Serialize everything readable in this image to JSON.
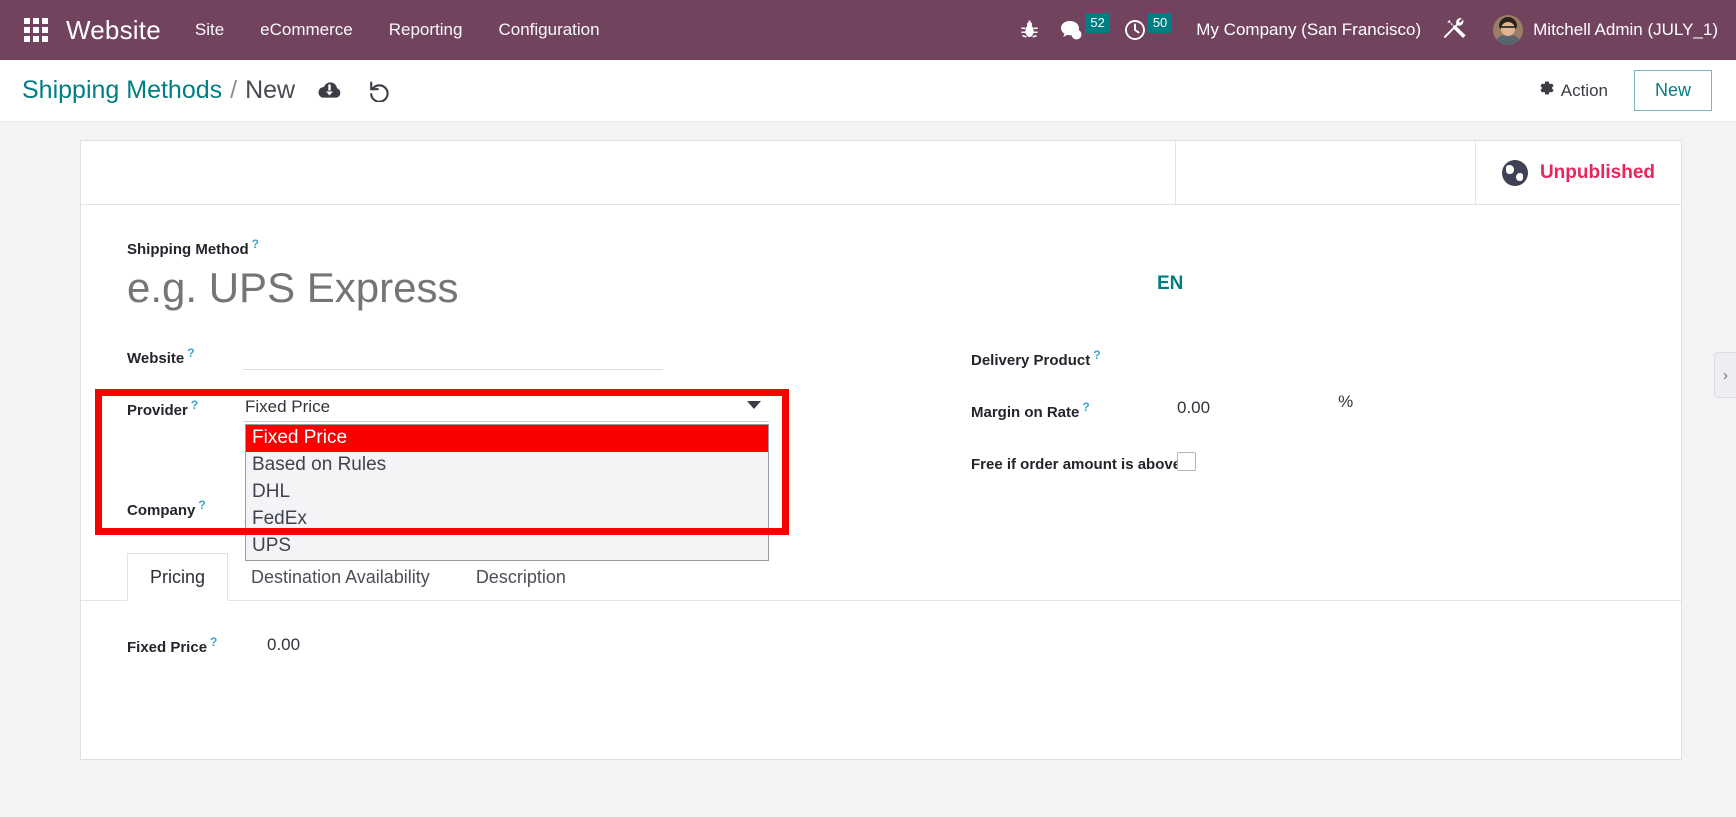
{
  "navbar": {
    "apps_icon": "apps-grid-icon",
    "brand": "Website",
    "menus": [
      {
        "label": "Site"
      },
      {
        "label": "eCommerce"
      },
      {
        "label": "Reporting"
      },
      {
        "label": "Configuration"
      }
    ],
    "bug_icon": "bug-icon",
    "messages_icon": "messages-icon",
    "messages_count": "52",
    "activities_icon": "clock-icon",
    "activities_count": "50",
    "company": "My Company (San Francisco)",
    "tools_icon": "wrench-screwdriver-icon",
    "avatar": "user-avatar",
    "username": "Mitchell Admin (JULY_1)",
    "badge_color": "#017e84",
    "bar_color": "#71435f"
  },
  "control_panel": {
    "breadcrumb_root": "Shipping Methods",
    "breadcrumb_sep": "/",
    "breadcrumb_current": "New",
    "save_icon": "cloud-upload-icon",
    "discard_icon": "undo-icon",
    "action_icon": "gear-icon",
    "action_label": "Action",
    "new_label": "New",
    "accent_color": "#017e84"
  },
  "sheet": {
    "status_icon": "globe-icon",
    "status_label": "Unpublished",
    "status_color": "#e8265b",
    "title_label": "Shipping Method",
    "title_placeholder": "e.g. UPS Express",
    "title_value": "",
    "language_badge": "EN",
    "tooltip_marker": "?"
  },
  "form": {
    "left": [
      {
        "label": "Website",
        "value": ""
      },
      {
        "label": "Provider",
        "value": "Fixed Price"
      },
      {
        "label": "Company",
        "value": ""
      }
    ],
    "right": [
      {
        "label": "Delivery Product",
        "value": ""
      },
      {
        "label": "Margin on Rate",
        "value": "0.00",
        "suffix": "%"
      },
      {
        "label": "Free if order amount is above",
        "value": "",
        "type": "checkbox"
      }
    ]
  },
  "provider_dropdown": {
    "open": true,
    "selected": "Fixed Price",
    "caret_icon": "chevron-down-icon",
    "options": [
      "Fixed Price",
      "Based on Rules",
      "DHL",
      "FedEx",
      "UPS"
    ],
    "highlight_color": "#fc0000",
    "list_bg": "#f4f4f6"
  },
  "notebook": {
    "tabs": [
      {
        "label": "Pricing",
        "active": true
      },
      {
        "label": "Destination Availability",
        "active": false
      },
      {
        "label": "Description",
        "active": false
      }
    ],
    "pricing": {
      "label": "Fixed Price",
      "value": "0.00"
    }
  },
  "annotation": {
    "color": "#fc0000",
    "note": "red-highlight-box-around-provider-dropdown"
  },
  "edge_panel": {
    "handle_icon": "chevron-right-icon"
  }
}
